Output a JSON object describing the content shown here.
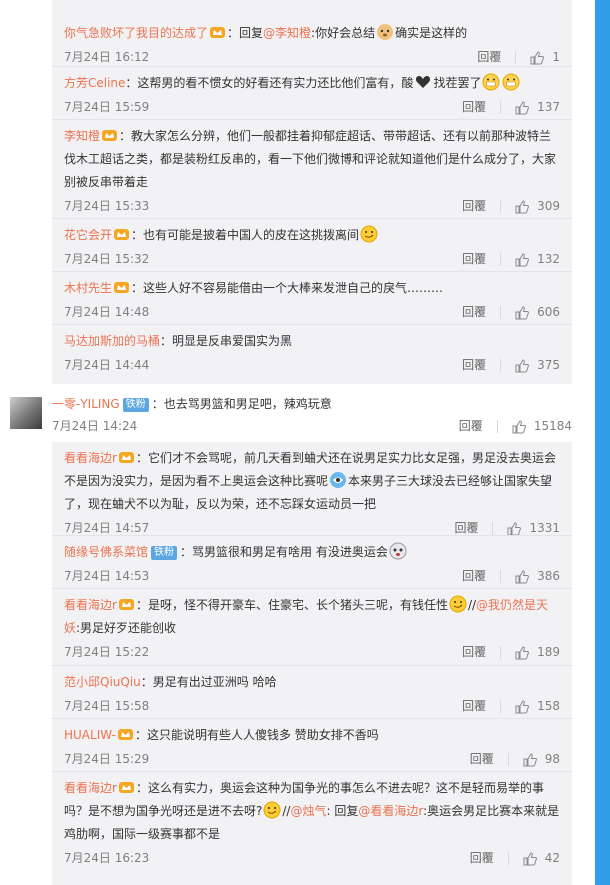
{
  "thread1": [
    {
      "user": "你气急败坏了我目的达成了",
      "badge": "crown",
      "pre": "：回复",
      "at": "@李知橙",
      "post": ":你好会总结",
      "emo": "dog-emoji",
      "post2": "确实是这样的",
      "date": "7月24日 16:12",
      "reply": "回覆",
      "likes": "1"
    },
    {
      "user": "方芳Celine",
      "badge": "",
      "pre": "：这帮男的看不惯女的好看还有实力还比他们富有，酸",
      "emo": "heart-emoji",
      "post": "找茬罢了",
      "emo2": "grin-emoji",
      "date": "7月24日 15:59",
      "reply": "回覆",
      "likes": "137"
    },
    {
      "user": "李知橙",
      "badge": "crown",
      "pre": "：教大家怎么分辨，他们一般都挂着抑郁症超话、带带超话、还有以前那种波特兰伐木工超话之类，都是装粉红反串的，看一下他们微博和评论就知道他们是什么成分了，大家别被反串带着走",
      "date": "7月24日 15:33",
      "reply": "回覆",
      "likes": "309"
    },
    {
      "user": "花它会开",
      "badge": "crown",
      "pre": "：也有可能是披着中国人的皮在这挑拨离间",
      "emo": "smirk-emoji",
      "date": "7月24日 15:32",
      "reply": "回覆",
      "likes": "132"
    },
    {
      "user": "木村先生",
      "badge": "crown",
      "pre": "：这些人好不容易能借由一个大棒来发泄自己的戾气………",
      "date": "7月24日 14:48",
      "reply": "回覆",
      "likes": "606"
    },
    {
      "user": "马达加斯加的马桶",
      "badge": "",
      "pre": "：明显是反串爱国实为黑",
      "date": "7月24日 14:44",
      "reply": "回覆",
      "likes": "375"
    }
  ],
  "top": {
    "user": "一零-YILING",
    "badge_text": "铁粉",
    "text": "：也去骂男篮和男足吧，辣鸡玩意",
    "date": "7月24日 14:24",
    "reply": "回覆",
    "likes": "15184"
  },
  "thread2": [
    {
      "user": "看看海边r",
      "badge": "crown",
      "pre": "：它们才不会骂呢，前几天看到蛐犬还在说男足实力比女足强，男足没去奥运会不是因为没实力，是因为看不上奥运会这种比赛呢",
      "emo": "doge-emoji",
      "post": "本来男子三大球没去已经够让国家失望了，现在蛐犬不以为耻，反以为荣，还不忘踩女运动员一把",
      "date": "7月24日 14:57",
      "reply": "回覆",
      "likes": "1331"
    },
    {
      "user": "随缘号佛系菜馆",
      "badge_text": "铁粉",
      "pre": "：骂男篮很和男足有啥用 有没进奥运会",
      "emo": "face-emoji",
      "date": "7月24日 14:53",
      "reply": "回覆",
      "likes": "386"
    },
    {
      "user": "看看海边r",
      "badge": "crown",
      "pre": "：是呀，怪不得开豪车、住豪宅、长个猪头三呢，有钱任性",
      "emo": "smirk-emoji",
      "mid": "//",
      "at": "@我仍然是天妖",
      "post": ":男足好歹还能创收",
      "date": "7月24日 15:22",
      "reply": "回覆",
      "likes": "189"
    },
    {
      "user": "范小邱QiuQiu",
      "badge": "",
      "pre": "：男足有出过亚洲吗 哈哈",
      "date": "7月24日 15:58",
      "reply": "回覆",
      "likes": "158"
    },
    {
      "user": "HUALIW-",
      "badge": "crown",
      "pre": "：这只能说明有些人人傻钱多 赞助女排不香吗",
      "date": "7月24日 15:29",
      "reply": "回覆",
      "likes": "98"
    },
    {
      "user": "看看海边r",
      "badge": "crown",
      "pre": "：这么有实力，奥运会这种为国争光的事怎么不进去呢？这不是轻而易举的事吗？是不想为国争光呀还是进不去呀?",
      "emo": "smirk-emoji",
      "mid": "//",
      "at": "@烛气",
      "mid2": ": 回复",
      "at2": "@看看海边r",
      "post": ":奥运会男足比赛本来就是鸡肋啊，国际一级赛事都不是",
      "date": "7月24日 16:23",
      "reply": "回覆",
      "likes": "42"
    }
  ]
}
